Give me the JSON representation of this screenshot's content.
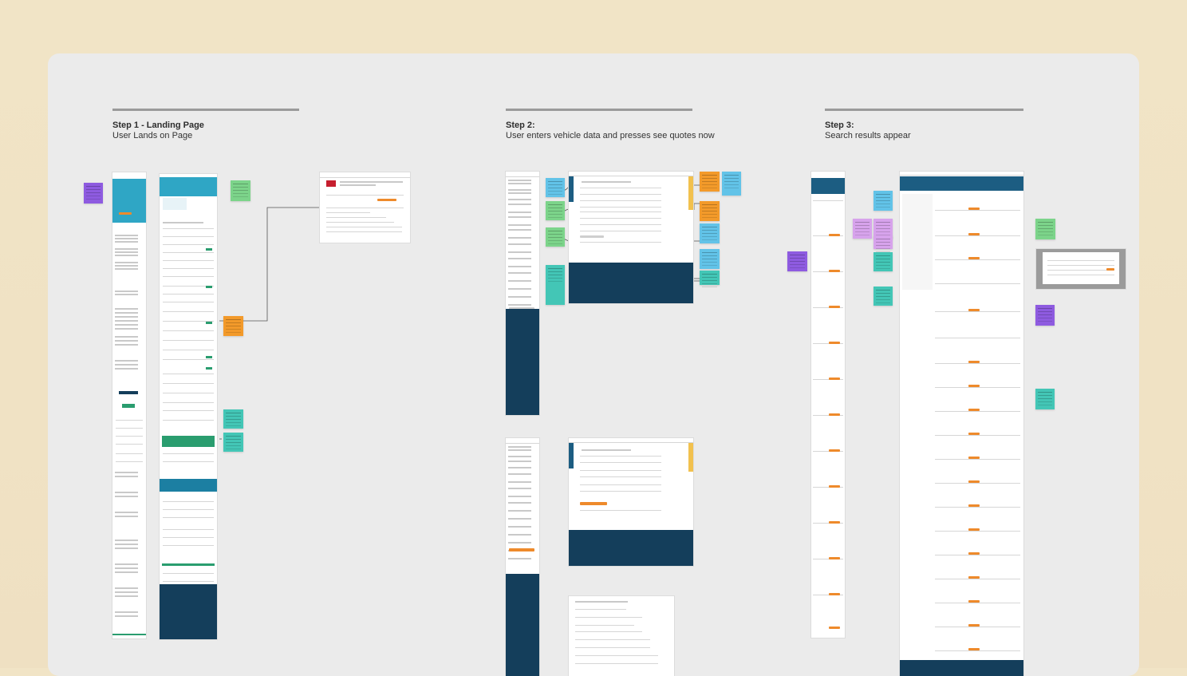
{
  "steps": [
    {
      "title": "Step 1 - Landing Page",
      "subtitle": "User Lands on Page"
    },
    {
      "title": "Step 2:",
      "subtitle": "User enters vehicle data and presses see quotes now"
    },
    {
      "title": "Step 3:",
      "subtitle": "Search results appear"
    }
  ],
  "colors": {
    "background": "#f1e4c6",
    "board": "#ebebeb",
    "brand_navy": "#143e5b",
    "brand_blue": "#2fa6c5",
    "cta_orange": "#ee8a2b",
    "sticky_purple": "#8e5be0",
    "sticky_green": "#7cd48a",
    "sticky_orange": "#f39a2a",
    "sticky_blue": "#62c3e8",
    "sticky_teal": "#43c6b6",
    "sticky_pink": "#d7a3ec"
  }
}
